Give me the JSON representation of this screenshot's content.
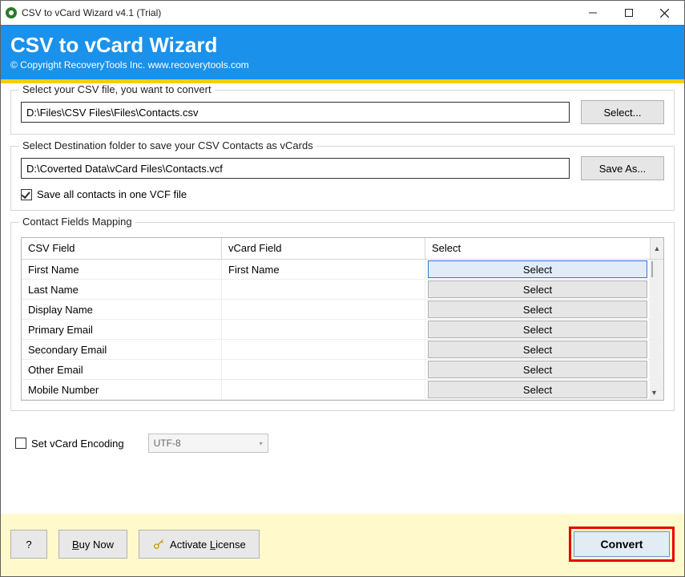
{
  "titlebar": {
    "title": "CSV to vCard Wizard v4.1 (Trial)"
  },
  "header": {
    "title": "CSV to vCard Wizard",
    "subtitle": "© Copyright RecoveryTools Inc. www.recoverytools.com"
  },
  "source": {
    "legend": "Select your CSV file, you want to convert",
    "path": "D:\\Files\\CSV Files\\Files\\Contacts.csv",
    "button": "Select..."
  },
  "dest": {
    "legend": "Select Destination folder to save your CSV Contacts as vCards",
    "path": "D:\\Coverted Data\\vCard Files\\Contacts.vcf",
    "button": "Save As...",
    "save_all_label": "Save all contacts in one VCF file",
    "save_all_checked": true
  },
  "mapping": {
    "legend": "Contact Fields Mapping",
    "columns": {
      "csv": "CSV Field",
      "vcard": "vCard Field",
      "select": "Select"
    },
    "select_button_label": "Select",
    "rows": [
      {
        "csv": "First Name",
        "vcard": "First Name",
        "active": true
      },
      {
        "csv": "Last Name",
        "vcard": "",
        "active": false
      },
      {
        "csv": "Display Name",
        "vcard": "",
        "active": false
      },
      {
        "csv": "Primary Email",
        "vcard": "",
        "active": false
      },
      {
        "csv": "Secondary Email",
        "vcard": "",
        "active": false
      },
      {
        "csv": "Other Email",
        "vcard": "",
        "active": false
      },
      {
        "csv": "Mobile Number",
        "vcard": "",
        "active": false
      }
    ]
  },
  "encoding": {
    "checkbox_label": "Set vCard Encoding",
    "checked": false,
    "combo_value": "UTF-8"
  },
  "bottom": {
    "help": "?",
    "buy_u": "B",
    "buy_rest": "uy Now",
    "activate_u": "L",
    "activate_pre": "Activate ",
    "activate_post": "icense",
    "convert": "Convert"
  }
}
